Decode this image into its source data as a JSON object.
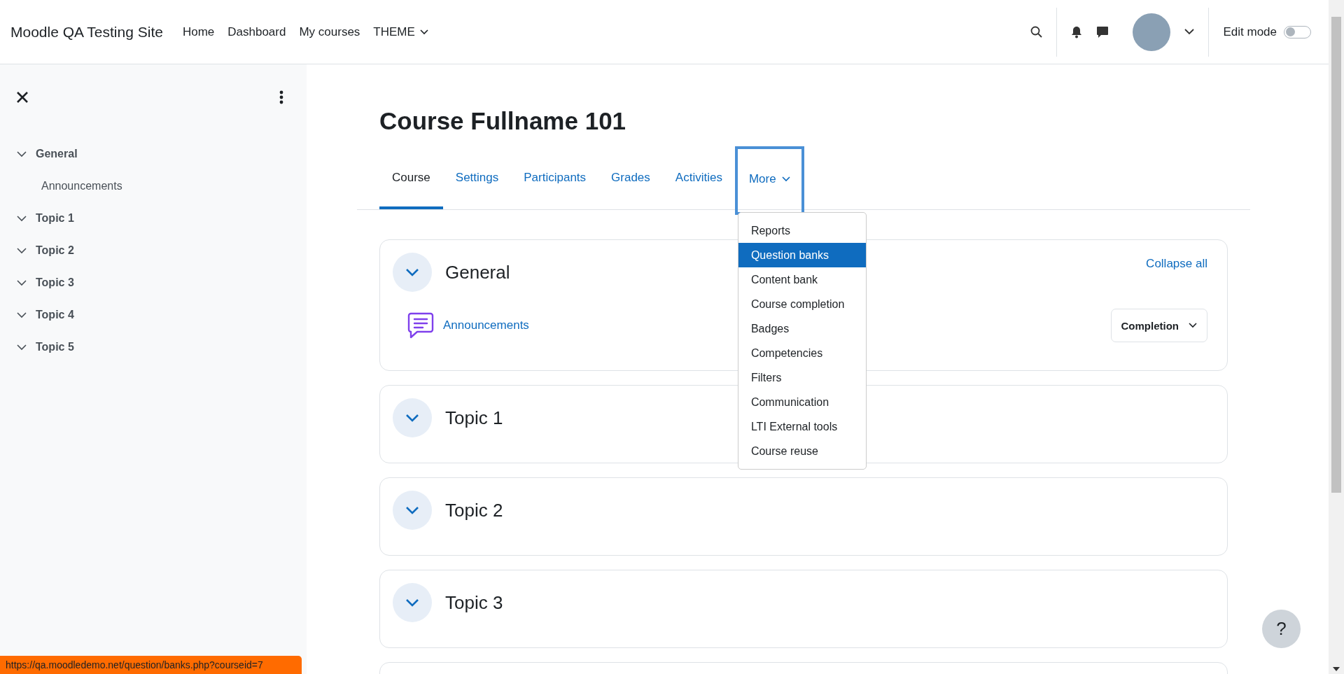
{
  "header": {
    "site_name": "Moodle QA Testing Site",
    "nav": [
      {
        "label": "Home",
        "dropdown": false
      },
      {
        "label": "Dashboard",
        "dropdown": false
      },
      {
        "label": "My courses",
        "dropdown": false
      },
      {
        "label": "THEME",
        "dropdown": true
      }
    ],
    "edit_mode": {
      "label": "Edit mode",
      "on": false
    }
  },
  "sidebar": {
    "items": [
      {
        "label": "General",
        "expanded": true,
        "children": [
          {
            "label": "Announcements"
          }
        ]
      },
      {
        "label": "Topic 1",
        "expanded": true
      },
      {
        "label": "Topic 2",
        "expanded": true
      },
      {
        "label": "Topic 3",
        "expanded": true
      },
      {
        "label": "Topic 4",
        "expanded": true
      },
      {
        "label": "Topic 5",
        "expanded": true
      }
    ]
  },
  "course": {
    "title": "Course Fullname 101",
    "tabs": [
      {
        "label": "Course",
        "selected": true,
        "focused": false,
        "dropdown": false
      },
      {
        "label": "Settings",
        "selected": false,
        "focused": false,
        "dropdown": false
      },
      {
        "label": "Participants",
        "selected": false,
        "focused": false,
        "dropdown": false
      },
      {
        "label": "Grades",
        "selected": false,
        "focused": false,
        "dropdown": false
      },
      {
        "label": "Activities",
        "selected": false,
        "focused": false,
        "dropdown": false
      },
      {
        "label": "More",
        "selected": false,
        "focused": true,
        "dropdown": true
      }
    ],
    "more_menu": [
      {
        "label": "Reports",
        "selected": false
      },
      {
        "label": "Question banks",
        "selected": true
      },
      {
        "label": "Content bank",
        "selected": false
      },
      {
        "label": "Course completion",
        "selected": false
      },
      {
        "label": "Badges",
        "selected": false
      },
      {
        "label": "Competencies",
        "selected": false
      },
      {
        "label": "Filters",
        "selected": false
      },
      {
        "label": "Communication",
        "selected": false
      },
      {
        "label": "LTI External tools",
        "selected": false
      },
      {
        "label": "Course reuse",
        "selected": false
      }
    ],
    "collapse_all": "Collapse all",
    "sections": [
      {
        "title": "General",
        "expanded": true,
        "activities": [
          {
            "name": "Announcements",
            "completion": "Completion"
          }
        ]
      },
      {
        "title": "Topic 1",
        "expanded": true
      },
      {
        "title": "Topic 2",
        "expanded": true
      },
      {
        "title": "Topic 3",
        "expanded": true
      }
    ]
  },
  "help_button": "?",
  "status_bar": "https://qa.moodledemo.net/question/banks.php?courseid=7"
}
